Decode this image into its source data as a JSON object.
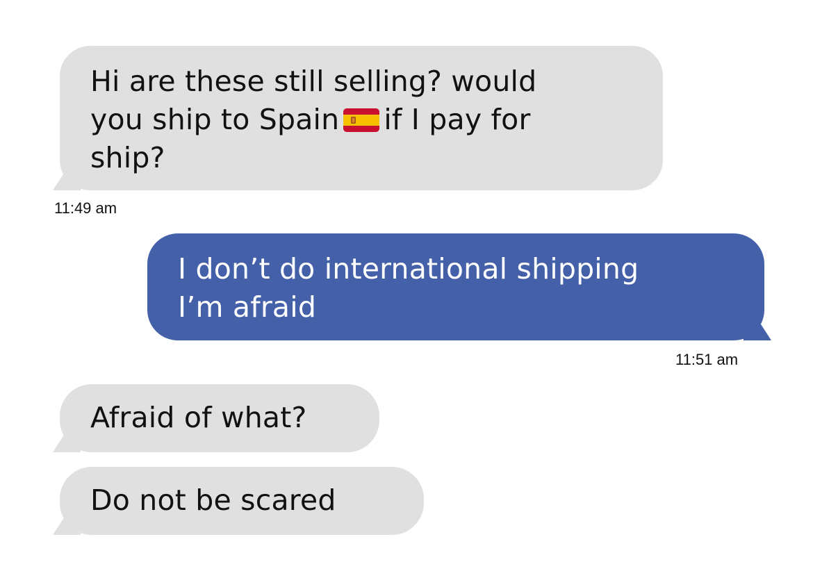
{
  "conversation": {
    "messages": [
      {
        "direction": "incoming",
        "lines": [
          "Hi are these still selling? would",
          "you ship to Spain",
          "if I pay for",
          "ship?"
        ],
        "emoji": "spain-flag-icon",
        "time": "11:49 am"
      },
      {
        "direction": "outgoing",
        "lines": [
          "I don’t do international shipping",
          "I’m afraid"
        ],
        "time": "11:51 am"
      },
      {
        "direction": "incoming",
        "lines": [
          "Afraid of what?"
        ]
      },
      {
        "direction": "incoming",
        "lines": [
          "Do not be scared"
        ]
      }
    ]
  },
  "colors": {
    "incoming_bubble": "#e0e0e0",
    "outgoing_bubble": "#4360a9",
    "incoming_text": "#111111",
    "outgoing_text": "#ffffff"
  }
}
